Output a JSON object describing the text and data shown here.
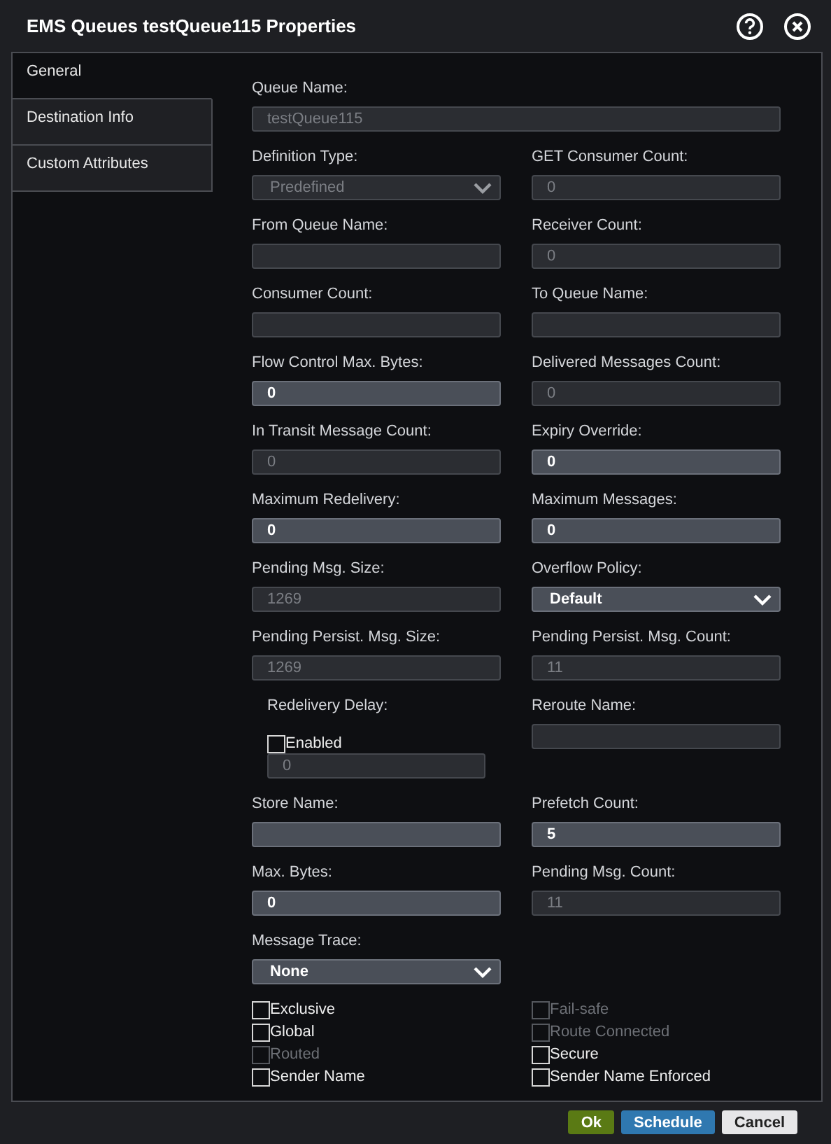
{
  "window": {
    "title": "EMS Queues testQueue115 Properties"
  },
  "tabs": [
    {
      "label": "General",
      "selected": true
    },
    {
      "label": "Destination Info",
      "selected": false
    },
    {
      "label": "Custom Attributes",
      "selected": false
    }
  ],
  "fields": [
    {
      "kind": "text",
      "label": "Queue Name:",
      "value": "testQueue115",
      "disabled": true,
      "wide": true
    },
    {
      "kind": "select",
      "label": "Definition Type:",
      "value": "Predefined",
      "disabled": true
    },
    {
      "kind": "text",
      "label": "GET Consumer Count:",
      "value": "0",
      "disabled": true
    },
    {
      "kind": "text",
      "label": "From Queue Name:",
      "disabled": true
    },
    {
      "kind": "text",
      "label": "Receiver Count:",
      "value": "0",
      "disabled": true
    },
    {
      "kind": "text",
      "label": "Consumer Count:",
      "disabled": true
    },
    {
      "kind": "text",
      "label": "To Queue Name:",
      "disabled": true
    },
    {
      "kind": "text",
      "label": "Flow Control Max. Bytes:",
      "value": "0",
      "disabled": false
    },
    {
      "kind": "text",
      "label": "Delivered Messages Count:",
      "value": "0",
      "disabled": true
    },
    {
      "kind": "text",
      "label": "In Transit Message Count:",
      "value": "0",
      "disabled": true
    },
    {
      "kind": "text",
      "label": "Expiry Override:",
      "value": "0",
      "disabled": false
    },
    {
      "kind": "text",
      "label": "Maximum Redelivery:",
      "value": "0",
      "disabled": false
    },
    {
      "kind": "text",
      "label": "Maximum Messages:",
      "value": "0",
      "disabled": false
    },
    {
      "kind": "text",
      "label": "Pending Msg. Size:",
      "value": "1269",
      "disabled": true
    },
    {
      "kind": "select",
      "label": "Overflow Policy:",
      "value": "Default",
      "disabled": false
    },
    {
      "kind": "text",
      "label": "Pending Persist. Msg. Size:",
      "value": "1269",
      "disabled": true
    },
    {
      "kind": "text",
      "label": "Pending Persist. Msg. Count:",
      "value": "11",
      "disabled": true
    },
    {
      "kind": "redelivery",
      "label": "Redelivery Delay:",
      "checkbox": {
        "label": "Enabled",
        "checked": false
      },
      "value": "0",
      "disabled": true
    },
    {
      "kind": "text",
      "label": "Reroute Name:",
      "disabled": true
    },
    {
      "kind": "text",
      "label": "Store Name:",
      "disabled": false
    },
    {
      "kind": "text",
      "label": "Prefetch Count:",
      "value": "5",
      "disabled": false
    },
    {
      "kind": "text",
      "label": "Max. Bytes:",
      "value": "0",
      "disabled": false
    },
    {
      "kind": "text",
      "label": "Pending Msg. Count:",
      "value": "11",
      "disabled": true
    },
    {
      "kind": "select",
      "label": "Message Trace:",
      "value": "None",
      "disabled": false
    }
  ],
  "checkboxes": [
    {
      "label": "Exclusive",
      "checked": false,
      "disabled": false
    },
    {
      "label": "Fail-safe",
      "checked": false,
      "disabled": true
    },
    {
      "label": "Global",
      "checked": false,
      "disabled": false
    },
    {
      "label": "Route Connected",
      "checked": false,
      "disabled": true
    },
    {
      "label": "Routed",
      "checked": false,
      "disabled": true
    },
    {
      "label": "Secure",
      "checked": false,
      "disabled": false
    },
    {
      "label": "Sender Name",
      "checked": false,
      "disabled": false
    },
    {
      "label": "Sender Name Enforced",
      "checked": false,
      "disabled": false
    }
  ],
  "buttons": [
    {
      "kind": "primary",
      "label": "Ok"
    },
    {
      "kind": "secondary",
      "label": "Schedule"
    },
    {
      "kind": "plain",
      "label": "Cancel"
    }
  ]
}
